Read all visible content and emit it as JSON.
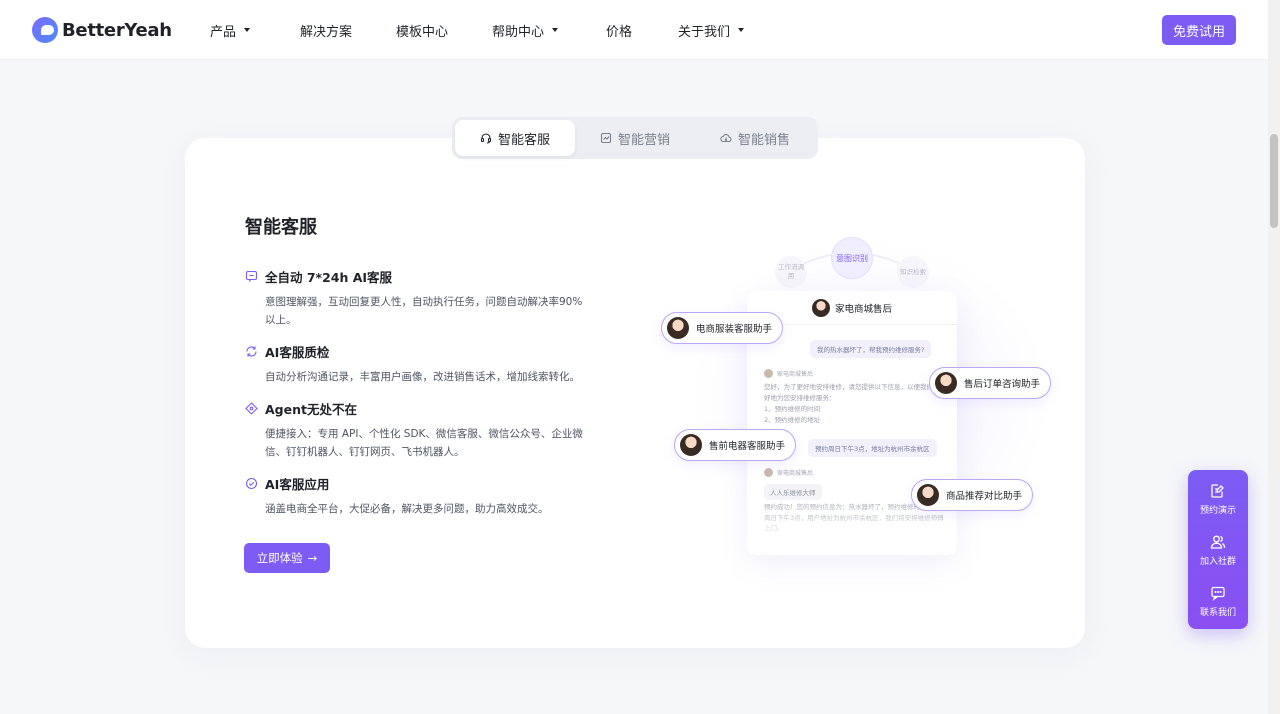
{
  "nav": {
    "logo_text": "BetterYeah",
    "menu": [
      {
        "label": "产品",
        "dropdown": true
      },
      {
        "label": "解决方案",
        "dropdown": false
      },
      {
        "label": "模板中心",
        "dropdown": false
      },
      {
        "label": "帮助中心",
        "dropdown": true
      },
      {
        "label": "价格",
        "dropdown": false
      },
      {
        "label": "关于我们",
        "dropdown": true
      }
    ],
    "trial_label": "免费试用"
  },
  "tabs": [
    {
      "label": "智能客服",
      "icon": "headset-icon",
      "active": true
    },
    {
      "label": "智能营销",
      "icon": "chart-icon",
      "active": false
    },
    {
      "label": "智能销售",
      "icon": "cloud-icon",
      "active": false
    }
  ],
  "section": {
    "title": "智能客服",
    "features": [
      {
        "title": "全自动 7*24h AI客服",
        "icon": "chat-icon",
        "desc": "意图理解强，互动回复更人性，自动执行任务，问题自动解决率90%以上。"
      },
      {
        "title": "AI客服质检",
        "icon": "refresh-icon",
        "desc": "自动分析沟通记录，丰富用户画像，改进销售话术，增加线索转化。"
      },
      {
        "title": "Agent无处不在",
        "icon": "network-icon",
        "desc": "便捷接入：专用 API、个性化 SDK、微信客服、微信公众号、企业微信、钉钉机器人、钉钉网页、飞书机器人。"
      },
      {
        "title": "AI客服应用",
        "icon": "check-badge-icon",
        "desc": "涵盖电商全平台，大促必备，解决更多问题，助力高效成交。"
      }
    ],
    "cta_label": "立即体验"
  },
  "illustration": {
    "orb_main": "意图识别",
    "orb_left": "工作流调用",
    "orb_right": "知识检索",
    "chat_title": "家电商城售后",
    "user_msg1": "我的热水器坏了，帮我预约维修服务?",
    "bot_label": "家电商城售后",
    "bot_msg1": "您好，为了更好地安排维修，请您提供以下信息，以便我们更好地为您安排维修服务：",
    "bot_item1": "1、预约维修的时间",
    "bot_item2": "2、预约维修的地址",
    "user_msg2": "预约周日下午3点，地址为杭州市余杭区",
    "bot_chip": "人人乐维修大师",
    "bot_msg2": "预约成功！您的预约信息为：热水器坏了，预约维修时间为本周日下午3点，用户地址为杭州市余杭区，我们将安排维修师傅上门。",
    "pills": [
      {
        "label": "电商服装客服助手"
      },
      {
        "label": "售后订单咨询助手"
      },
      {
        "label": "售前电器客服助手"
      },
      {
        "label": "商品推荐对比助手"
      }
    ]
  },
  "float_panel": [
    {
      "label": "预约演示",
      "icon": "edit-icon"
    },
    {
      "label": "加入社群",
      "icon": "users-icon"
    },
    {
      "label": "联系我们",
      "icon": "message-icon"
    }
  ],
  "colors": {
    "accent": "#7c5cf5",
    "text": "#1f2329",
    "muted": "#4e5563",
    "background": "#f6f7f9"
  }
}
